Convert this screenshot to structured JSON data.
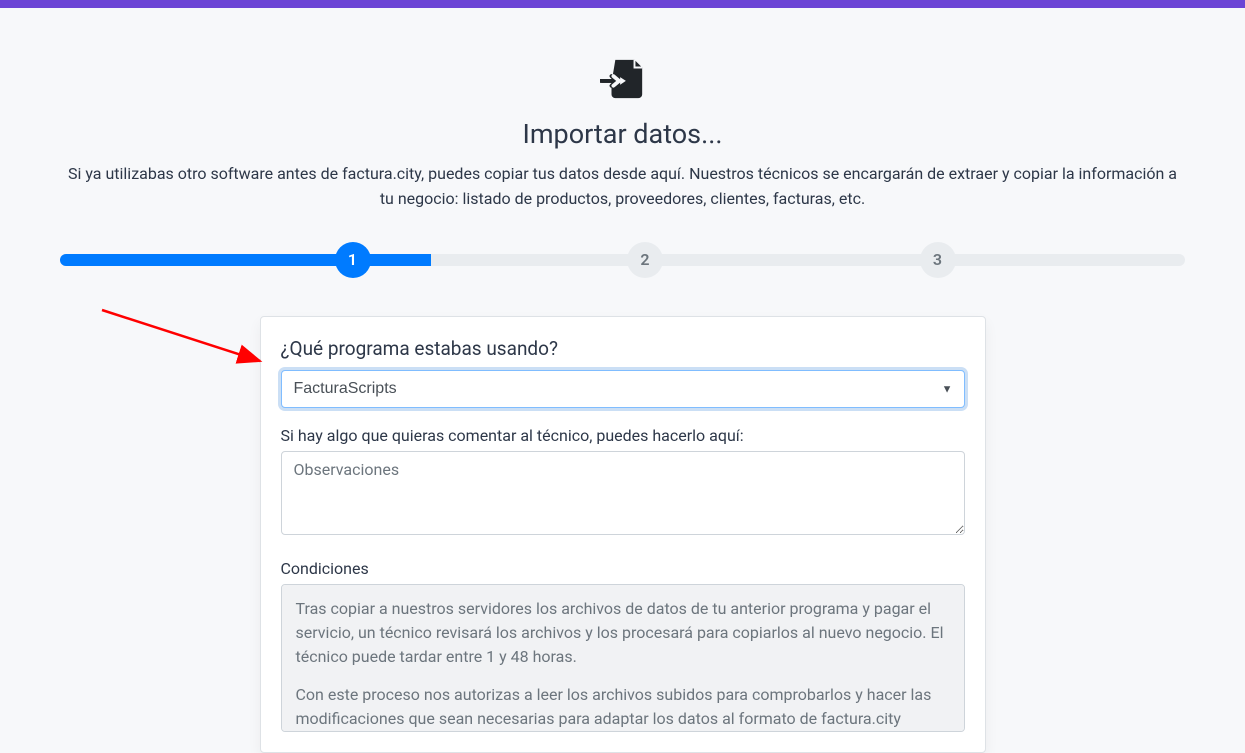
{
  "header": {
    "title": "Importar datos...",
    "description": "Si ya utilizabas otro software antes de factura.city, puedes copiar tus datos desde aquí. Nuestros técnicos se encargarán de extraer y copiar la información a tu negocio: listado de productos, proveedores, clientes, facturas, etc."
  },
  "progress": {
    "steps": [
      "1",
      "2",
      "3"
    ],
    "active_step_index": 0,
    "fill_percent": 33
  },
  "form": {
    "program_question": "¿Qué programa estabas usando?",
    "program_value": "FacturaScripts",
    "comment_label": "Si hay algo que quieras comentar al técnico, puedes hacerlo aquí:",
    "comment_placeholder": "Observaciones",
    "conditions_label": "Condiciones",
    "conditions_p1": "Tras copiar a nuestros servidores los archivos de datos de tu anterior programa y pagar el servicio, un técnico revisará los archivos y los procesará para copiarlos al nuevo negocio. El técnico puede tardar entre 1 y 48 horas.",
    "conditions_p2": "Con este proceso nos autorizas a leer los archivos subidos para comprobarlos y hacer las modificaciones que sean necesarias para adaptar los datos al formato de factura.city"
  }
}
